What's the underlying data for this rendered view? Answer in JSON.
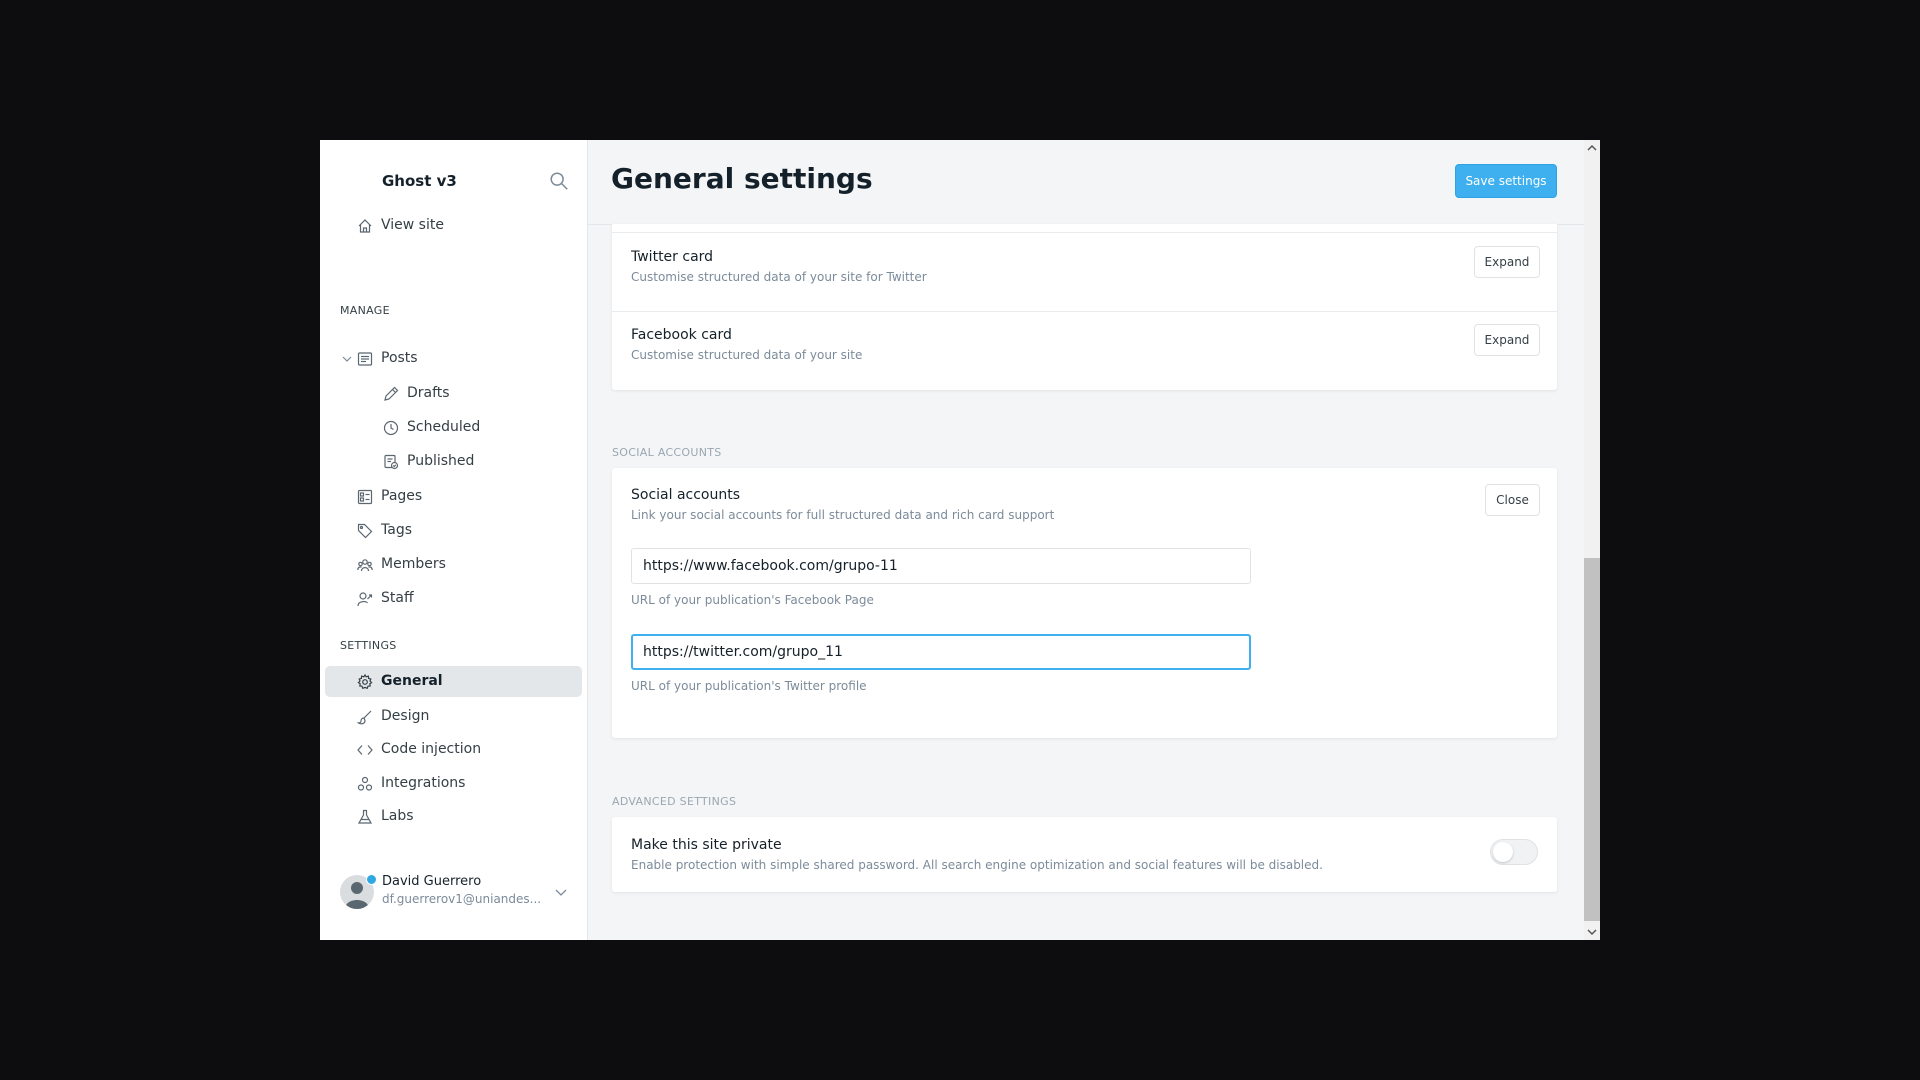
{
  "app": {
    "brand": "Ghost v3"
  },
  "sidebar": {
    "view_site": "View site",
    "manage_header": "MANAGE",
    "manage_items": [
      {
        "label": "Posts",
        "icon": "posts-icon"
      },
      {
        "label": "Drafts",
        "icon": "pencil-icon"
      },
      {
        "label": "Scheduled",
        "icon": "clock-icon"
      },
      {
        "label": "Published",
        "icon": "published-icon"
      },
      {
        "label": "Pages",
        "icon": "pages-icon"
      },
      {
        "label": "Tags",
        "icon": "tag-icon"
      },
      {
        "label": "Members",
        "icon": "members-icon"
      },
      {
        "label": "Staff",
        "icon": "staff-icon"
      }
    ],
    "settings_header": "SETTINGS",
    "settings_items": [
      {
        "label": "General",
        "icon": "gear-icon",
        "active": true
      },
      {
        "label": "Design",
        "icon": "brush-icon"
      },
      {
        "label": "Code injection",
        "icon": "code-icon"
      },
      {
        "label": "Integrations",
        "icon": "integrations-icon"
      },
      {
        "label": "Labs",
        "icon": "flask-icon"
      }
    ],
    "user": {
      "name": "David Guerrero",
      "email": "df.guerrerov1@uniandes..."
    }
  },
  "header": {
    "title": "General settings",
    "save_label": "Save settings"
  },
  "cards": {
    "twitter": {
      "title": "Twitter card",
      "desc": "Customise structured data of your site for Twitter",
      "button": "Expand"
    },
    "facebook": {
      "title": "Facebook card",
      "desc": "Customise structured data of your site",
      "button": "Expand"
    }
  },
  "social": {
    "section_label": "SOCIAL ACCOUNTS",
    "title": "Social accounts",
    "desc": "Link your social accounts for full structured data and rich card support",
    "button": "Close",
    "facebook_value": "https://www.facebook.com/grupo-11",
    "facebook_help": "URL of your publication's Facebook Page",
    "twitter_value": "https://twitter.com/grupo_11",
    "twitter_help": "URL of your publication's Twitter profile"
  },
  "advanced": {
    "section_label": "ADVANCED SETTINGS",
    "private_title": "Make this site private",
    "private_desc": "Enable protection with simple shared password. All search engine optimization and social features will be disabled.",
    "private_enabled": false
  },
  "colors": {
    "accent": "#3eb0ef",
    "active_bg": "#e3e7ea",
    "page_bg": "#f4f5f7"
  }
}
